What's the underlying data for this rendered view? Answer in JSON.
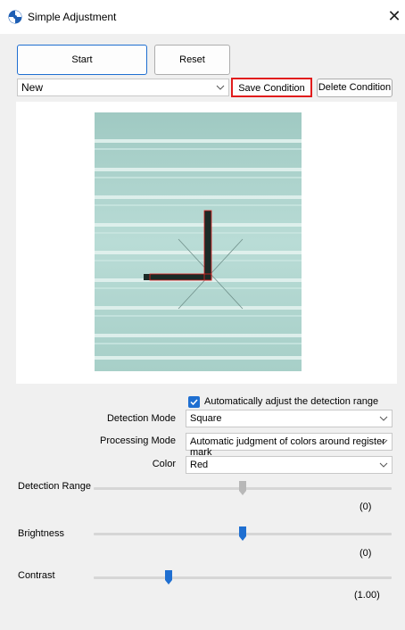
{
  "window": {
    "title": "Simple Adjustment",
    "close_glyph": "✕"
  },
  "toolbar": {
    "start_label": "Start",
    "reset_label": "Reset"
  },
  "condition": {
    "selected": "New",
    "save_label": "Save Condition",
    "delete_label": "Delete Condition",
    "highlight_color": "#e11c1c"
  },
  "options": {
    "auto_adjust_checked": true,
    "auto_adjust_label": "Automatically adjust the detection range",
    "detection_mode_label": "Detection Mode",
    "detection_mode_value": "Square",
    "processing_mode_label": "Processing Mode",
    "processing_mode_value": "Automatic judgment of colors around register mark",
    "color_label": "Color",
    "color_value": "Red"
  },
  "sliders": {
    "detection_range": {
      "label": "Detection Range",
      "readout": "(0)",
      "level": 0.5,
      "enabled": false
    },
    "brightness": {
      "label": "Brightness",
      "readout": "(0)",
      "level": 0.5,
      "enabled": true
    },
    "contrast": {
      "label": "Contrast",
      "readout": "(1.00)",
      "level": 0.25,
      "enabled": true
    }
  },
  "colors": {
    "accent": "#1f6fd1",
    "slider_disabled": "#b8b8b8"
  }
}
